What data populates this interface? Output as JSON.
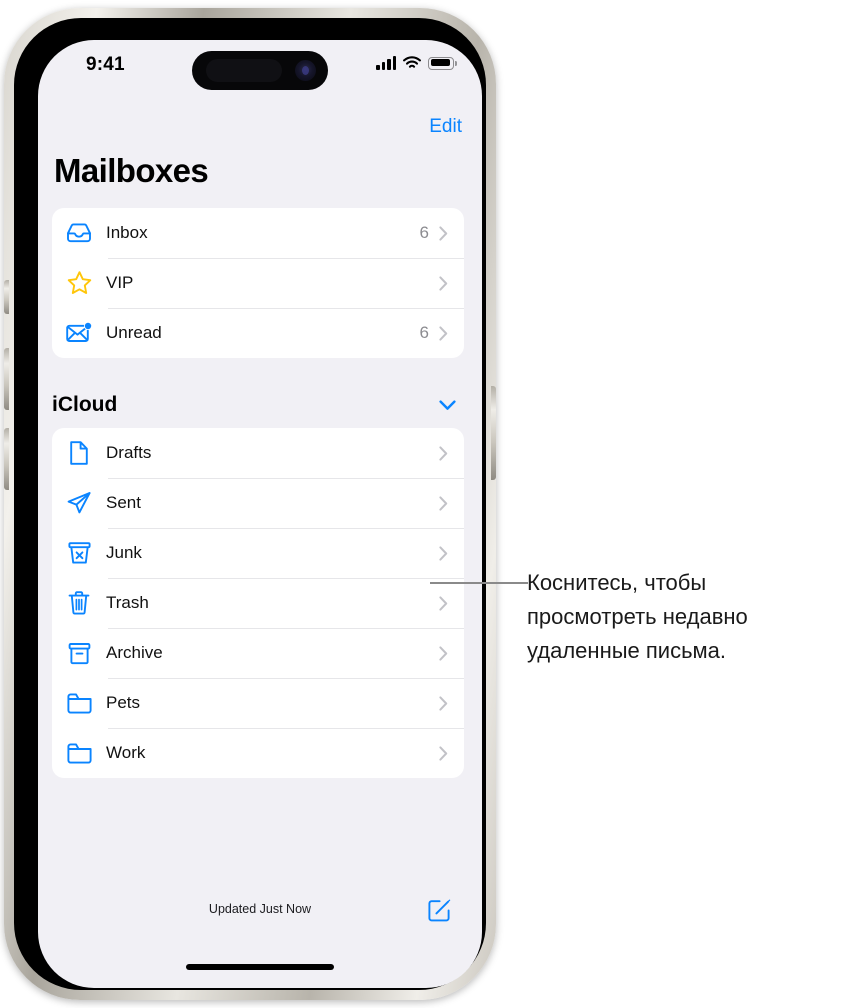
{
  "status_bar": {
    "time": "9:41",
    "signal_icon": "cellular-bars-icon",
    "wifi_icon": "wifi-icon",
    "battery_icon": "battery-full-icon"
  },
  "nav": {
    "edit_label": "Edit",
    "title": "Mailboxes"
  },
  "colors": {
    "accent": "#0a84ff",
    "vip_star": "#ffc60a",
    "screen_bg": "#f1f0f5",
    "card_bg": "#ffffff",
    "separator": "#e6e6e9",
    "chevron": "#c2c2c7",
    "count_text": "#8c8c91"
  },
  "primary_mailboxes": [
    {
      "label": "Inbox",
      "count": "6",
      "icon": "inbox-tray-icon",
      "chevron": "chevron-right-icon"
    },
    {
      "label": "VIP",
      "count": "",
      "icon": "star-icon",
      "chevron": "chevron-right-icon"
    },
    {
      "label": "Unread",
      "count": "6",
      "icon": "envelope-badge-icon",
      "chevron": "chevron-right-icon"
    }
  ],
  "icloud_section": {
    "title": "iCloud",
    "collapse_icon": "chevron-down-icon",
    "mailboxes": [
      {
        "label": "Drafts",
        "count": "",
        "icon": "document-icon",
        "chevron": "chevron-right-icon"
      },
      {
        "label": "Sent",
        "count": "",
        "icon": "paper-plane-icon",
        "chevron": "chevron-right-icon"
      },
      {
        "label": "Junk",
        "count": "",
        "icon": "junk-bin-x-icon",
        "chevron": "chevron-right-icon"
      },
      {
        "label": "Trash",
        "count": "",
        "icon": "trash-can-icon",
        "chevron": "chevron-right-icon"
      },
      {
        "label": "Archive",
        "count": "",
        "icon": "archive-box-icon",
        "chevron": "chevron-right-icon"
      },
      {
        "label": "Pets",
        "count": "",
        "icon": "folder-icon",
        "chevron": "chevron-right-icon"
      },
      {
        "label": "Work",
        "count": "",
        "icon": "folder-icon",
        "chevron": "chevron-right-icon"
      }
    ]
  },
  "toolbar": {
    "updated_status": "Updated Just Now",
    "compose_icon": "compose-pencil-square-icon"
  },
  "callout": {
    "text": "Коснитесь, чтобы просмотреть недавно удаленные письма.",
    "target_row": "Trash"
  }
}
